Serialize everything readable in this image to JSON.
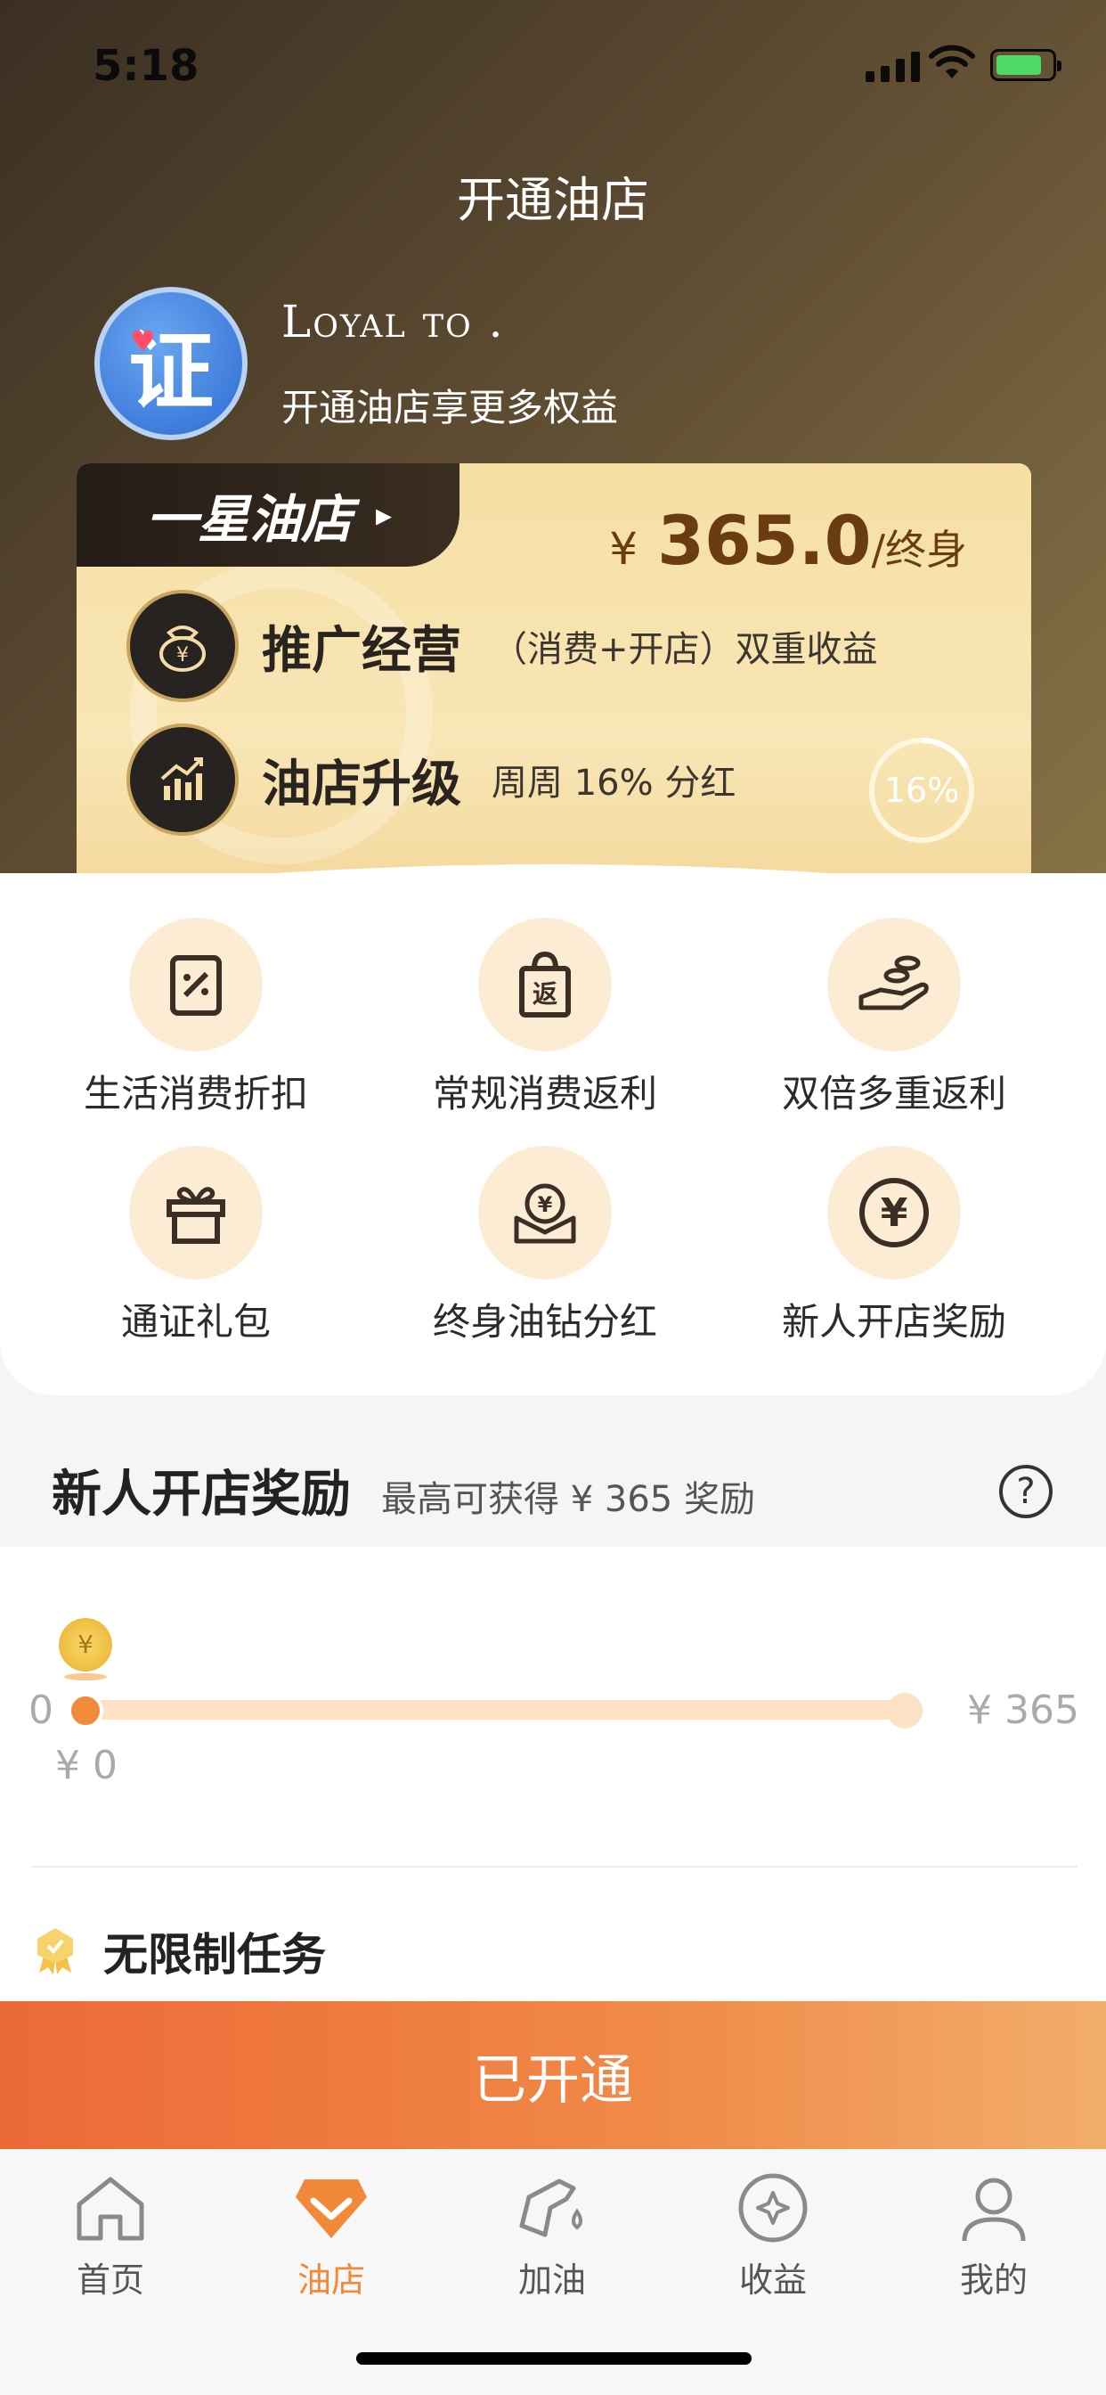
{
  "status_bar": {
    "time": "5:18"
  },
  "header": {
    "title": "开通油店"
  },
  "user": {
    "name": "Loyal to .",
    "subtitle": "开通油店享更多权益",
    "avatar_glyph": "证"
  },
  "card": {
    "tier_label": "一星油店",
    "price": {
      "currency": "¥",
      "amount": "365.0",
      "unit": "/终身"
    },
    "perks": [
      {
        "title": "推广经营",
        "desc": "（消费+开店）双重收益",
        "icon": "money-bag-icon"
      },
      {
        "title": "油店升级",
        "desc": "周周 16% 分红",
        "icon": "growth-chart-icon"
      }
    ],
    "ring_label": "16%"
  },
  "benefits": [
    {
      "label": "生活消费折扣",
      "icon": "discount-tag-icon"
    },
    {
      "label": "常规消费返利",
      "icon": "rebate-bag-icon"
    },
    {
      "label": "双倍多重返利",
      "icon": "coins-hand-icon"
    },
    {
      "label": "通证礼包",
      "icon": "gift-icon"
    },
    {
      "label": "终身油钻分红",
      "icon": "dividend-pocket-icon"
    },
    {
      "label": "新人开店奖励",
      "icon": "yuan-coin-icon"
    }
  ],
  "reward_section": {
    "title": "新人开店奖励",
    "subtitle": "最高可获得 ¥ 365 奖励",
    "progress": {
      "start_label": "0",
      "end_label": "¥ 365",
      "current_label": "¥ 0",
      "coin_symbol": "¥",
      "value": 0,
      "max": 365
    },
    "task_title": "无限制任务"
  },
  "cta": {
    "label": "已开通"
  },
  "tabbar": {
    "items": [
      {
        "label": "首页",
        "icon": "home-icon",
        "active": false
      },
      {
        "label": "油店",
        "icon": "shop-diamond-icon",
        "active": true
      },
      {
        "label": "加油",
        "icon": "fuel-nozzle-icon",
        "active": false
      },
      {
        "label": "收益",
        "icon": "earnings-coin-icon",
        "active": false
      },
      {
        "label": "我的",
        "icon": "profile-icon",
        "active": false
      }
    ]
  },
  "colors": {
    "accent": "#f08a3a",
    "hero_dark": "#3a2f22",
    "card_gold": "#f6dfa3"
  }
}
